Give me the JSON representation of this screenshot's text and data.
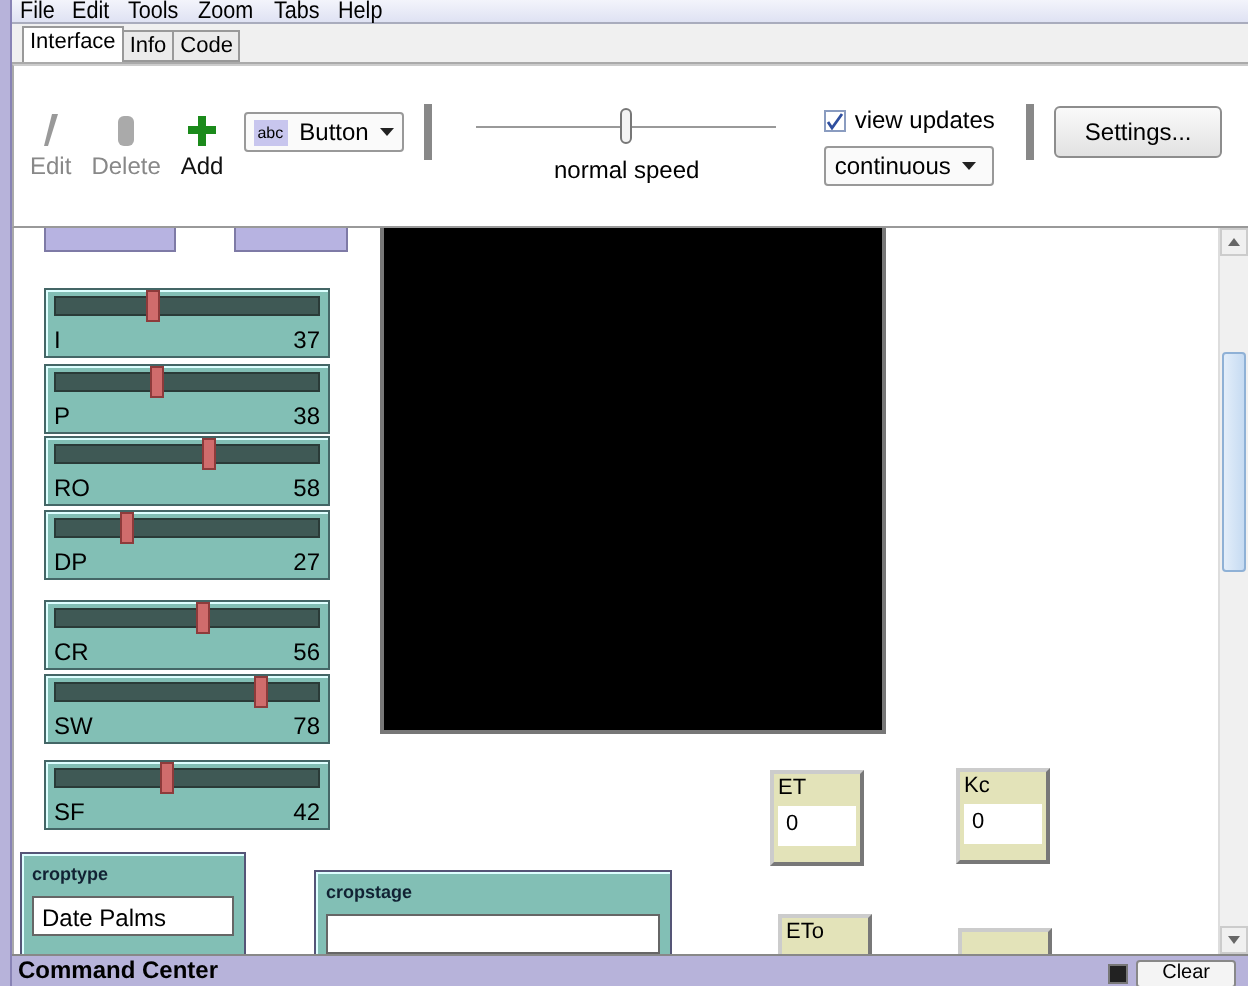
{
  "menu": [
    "File",
    "Edit",
    "Tools",
    "Zoom",
    "Tabs",
    "Help"
  ],
  "tabs": [
    {
      "label": "Interface",
      "selected": true
    },
    {
      "label": "Info",
      "selected": false
    },
    {
      "label": "Code",
      "selected": false
    }
  ],
  "toolbar": {
    "edit": {
      "label": "Edit",
      "disabled": true
    },
    "delete": {
      "label": "Delete",
      "disabled": true
    },
    "add": {
      "label": "Add",
      "disabled": false
    },
    "widget_type": {
      "icon_text": "abc",
      "value": "Button"
    },
    "speed": {
      "label": "normal speed",
      "level": 0.5
    },
    "view_updates": {
      "label": "view updates",
      "checked": true
    },
    "update_mode": {
      "value": "continuous"
    },
    "settings": "Settings..."
  },
  "sliders": [
    {
      "name": "I",
      "value": "37",
      "level": 0.37
    },
    {
      "name": "P",
      "value": "38",
      "level": 0.38
    },
    {
      "name": "RO",
      "value": "58",
      "level": 0.58
    },
    {
      "name": "DP",
      "value": "27",
      "level": 0.27
    },
    {
      "name": "CR",
      "value": "56",
      "level": 0.56
    },
    {
      "name": "SW",
      "value": "78",
      "level": 0.78
    },
    {
      "name": "SF",
      "value": "42",
      "level": 0.42
    }
  ],
  "monitors": [
    {
      "label": "ET",
      "value": "0"
    },
    {
      "label": "Kc",
      "value": "0"
    },
    {
      "label": "ETo"
    }
  ],
  "choosers": [
    {
      "label": "croptype",
      "value": "Date  Palms"
    },
    {
      "label": "cropstage"
    }
  ],
  "command_center": {
    "title": "Command Center",
    "clear": "Clear"
  }
}
